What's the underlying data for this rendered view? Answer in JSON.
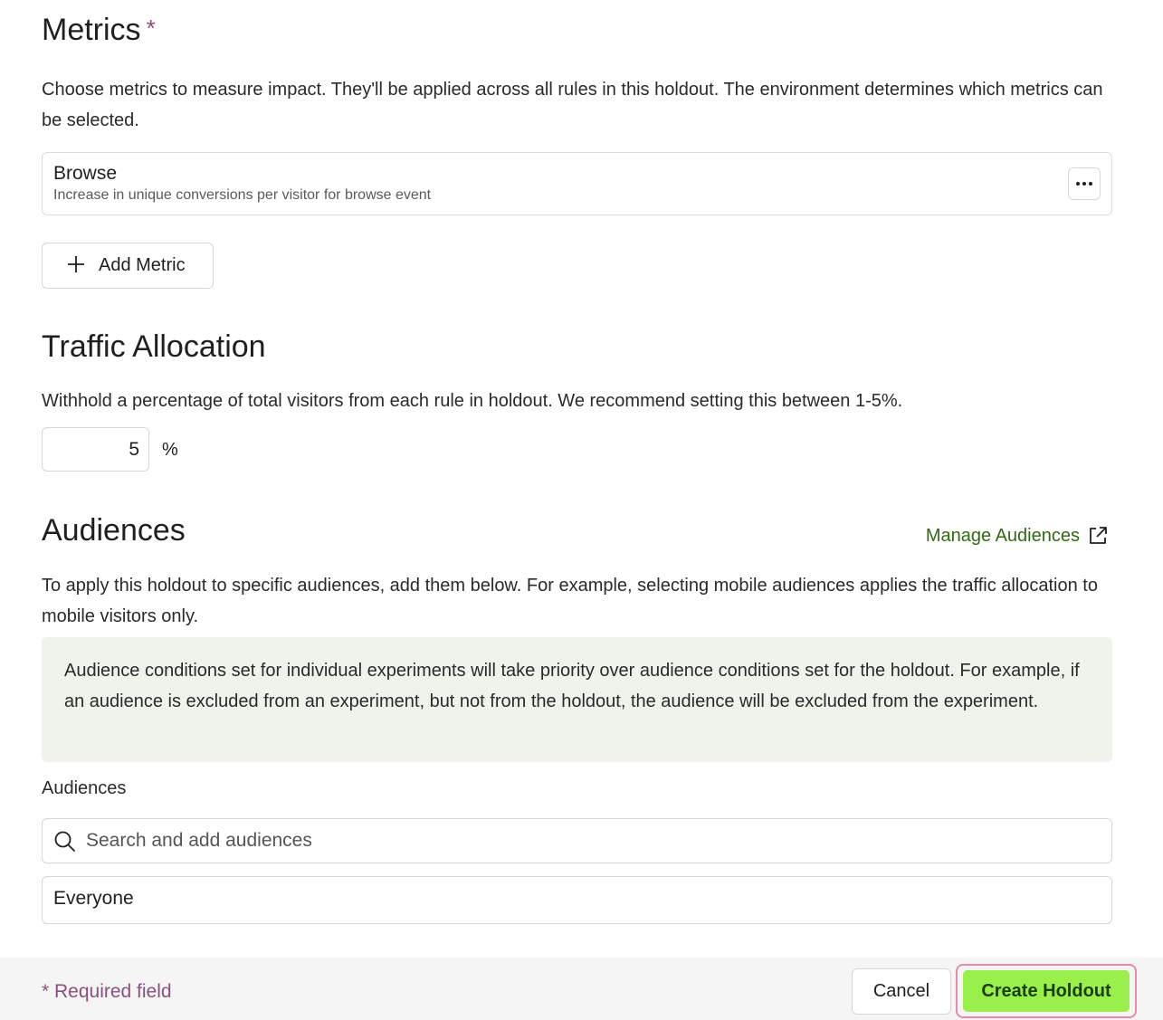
{
  "metrics": {
    "heading": "Metrics",
    "required_marker": "*",
    "description": "Choose metrics to measure impact. They'll be applied across all rules in this holdout. The environment determines which metrics can be selected.",
    "items": [
      {
        "name": "Browse",
        "subtitle": "Increase in unique conversions per visitor for browse event"
      }
    ],
    "add_button_label": "Add Metric"
  },
  "traffic": {
    "heading": "Traffic Allocation",
    "description": "Withhold a percentage of total visitors from each rule in holdout. We recommend setting this between 1-5%.",
    "value": "5",
    "unit": "%"
  },
  "audiences": {
    "heading": "Audiences",
    "manage_link": "Manage Audiences",
    "description": "To apply this holdout to specific audiences, add them below. For example, selecting mobile audiences applies the traffic allocation to mobile visitors only.",
    "notice": "Audience conditions set for individual experiments will take priority over audience conditions set for the holdout. For example, if an audience is excluded from an experiment, but not from the holdout, the audience will be excluded from the experiment.",
    "field_label": "Audiences",
    "search_placeholder": "Search and add audiences",
    "selected": "Everyone"
  },
  "footer": {
    "required_note": "* Required field",
    "cancel_label": "Cancel",
    "create_label": "Create Holdout"
  },
  "colors": {
    "accent_green": "#99f04b",
    "link_green": "#2f6b12",
    "required_color": "#8a4f7d",
    "notice_bg": "#eef4ec"
  },
  "icons": [
    "more-icon",
    "plus-icon",
    "external-link-icon",
    "search-icon"
  ]
}
